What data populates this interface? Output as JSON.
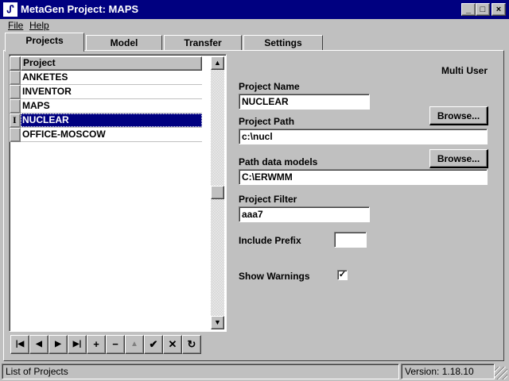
{
  "window": {
    "title": "MetaGen  Project: MAPS",
    "minimize": "_",
    "maximize": "□",
    "close": "×"
  },
  "menu": {
    "items": [
      {
        "label": "File"
      },
      {
        "label": "Help"
      }
    ]
  },
  "tabs": [
    {
      "label": "Projects",
      "active": true
    },
    {
      "label": "Model"
    },
    {
      "label": "Transfer"
    },
    {
      "label": "Settings"
    }
  ],
  "grid": {
    "header": "Project",
    "rows": [
      "ANKETES",
      "INVENTOR",
      "MAPS",
      "NUCLEAR",
      "OFFICE-MOSCOW"
    ],
    "selected_index": 3,
    "selected_marker": "I",
    "scroll_up": "▲",
    "scroll_down": "▼"
  },
  "navigator": {
    "first": "|◀",
    "prior": "◀",
    "next": "▶",
    "last": "▶|",
    "insert": "+",
    "delete": "−",
    "edit": "▲",
    "post": "✔",
    "cancel": "✕",
    "refresh": "↻"
  },
  "details": {
    "mode": "Multi User",
    "project_name_label": "Project Name",
    "project_name_value": "NUCLEAR",
    "project_path_label": "Project Path",
    "project_path_value": "c:\\nucl",
    "browse_label": "Browse...",
    "path_models_label": "Path data models",
    "path_models_value": "C:\\ERWMM",
    "project_filter_label": "Project Filter",
    "project_filter_value": "aaa7",
    "include_prefix_label": "Include Prefix",
    "include_prefix_value": "",
    "show_warnings_label": "Show Warnings",
    "show_warnings_mark": "✓"
  },
  "status": {
    "left": "List of Projects",
    "version": "Version:  1.18.10"
  }
}
